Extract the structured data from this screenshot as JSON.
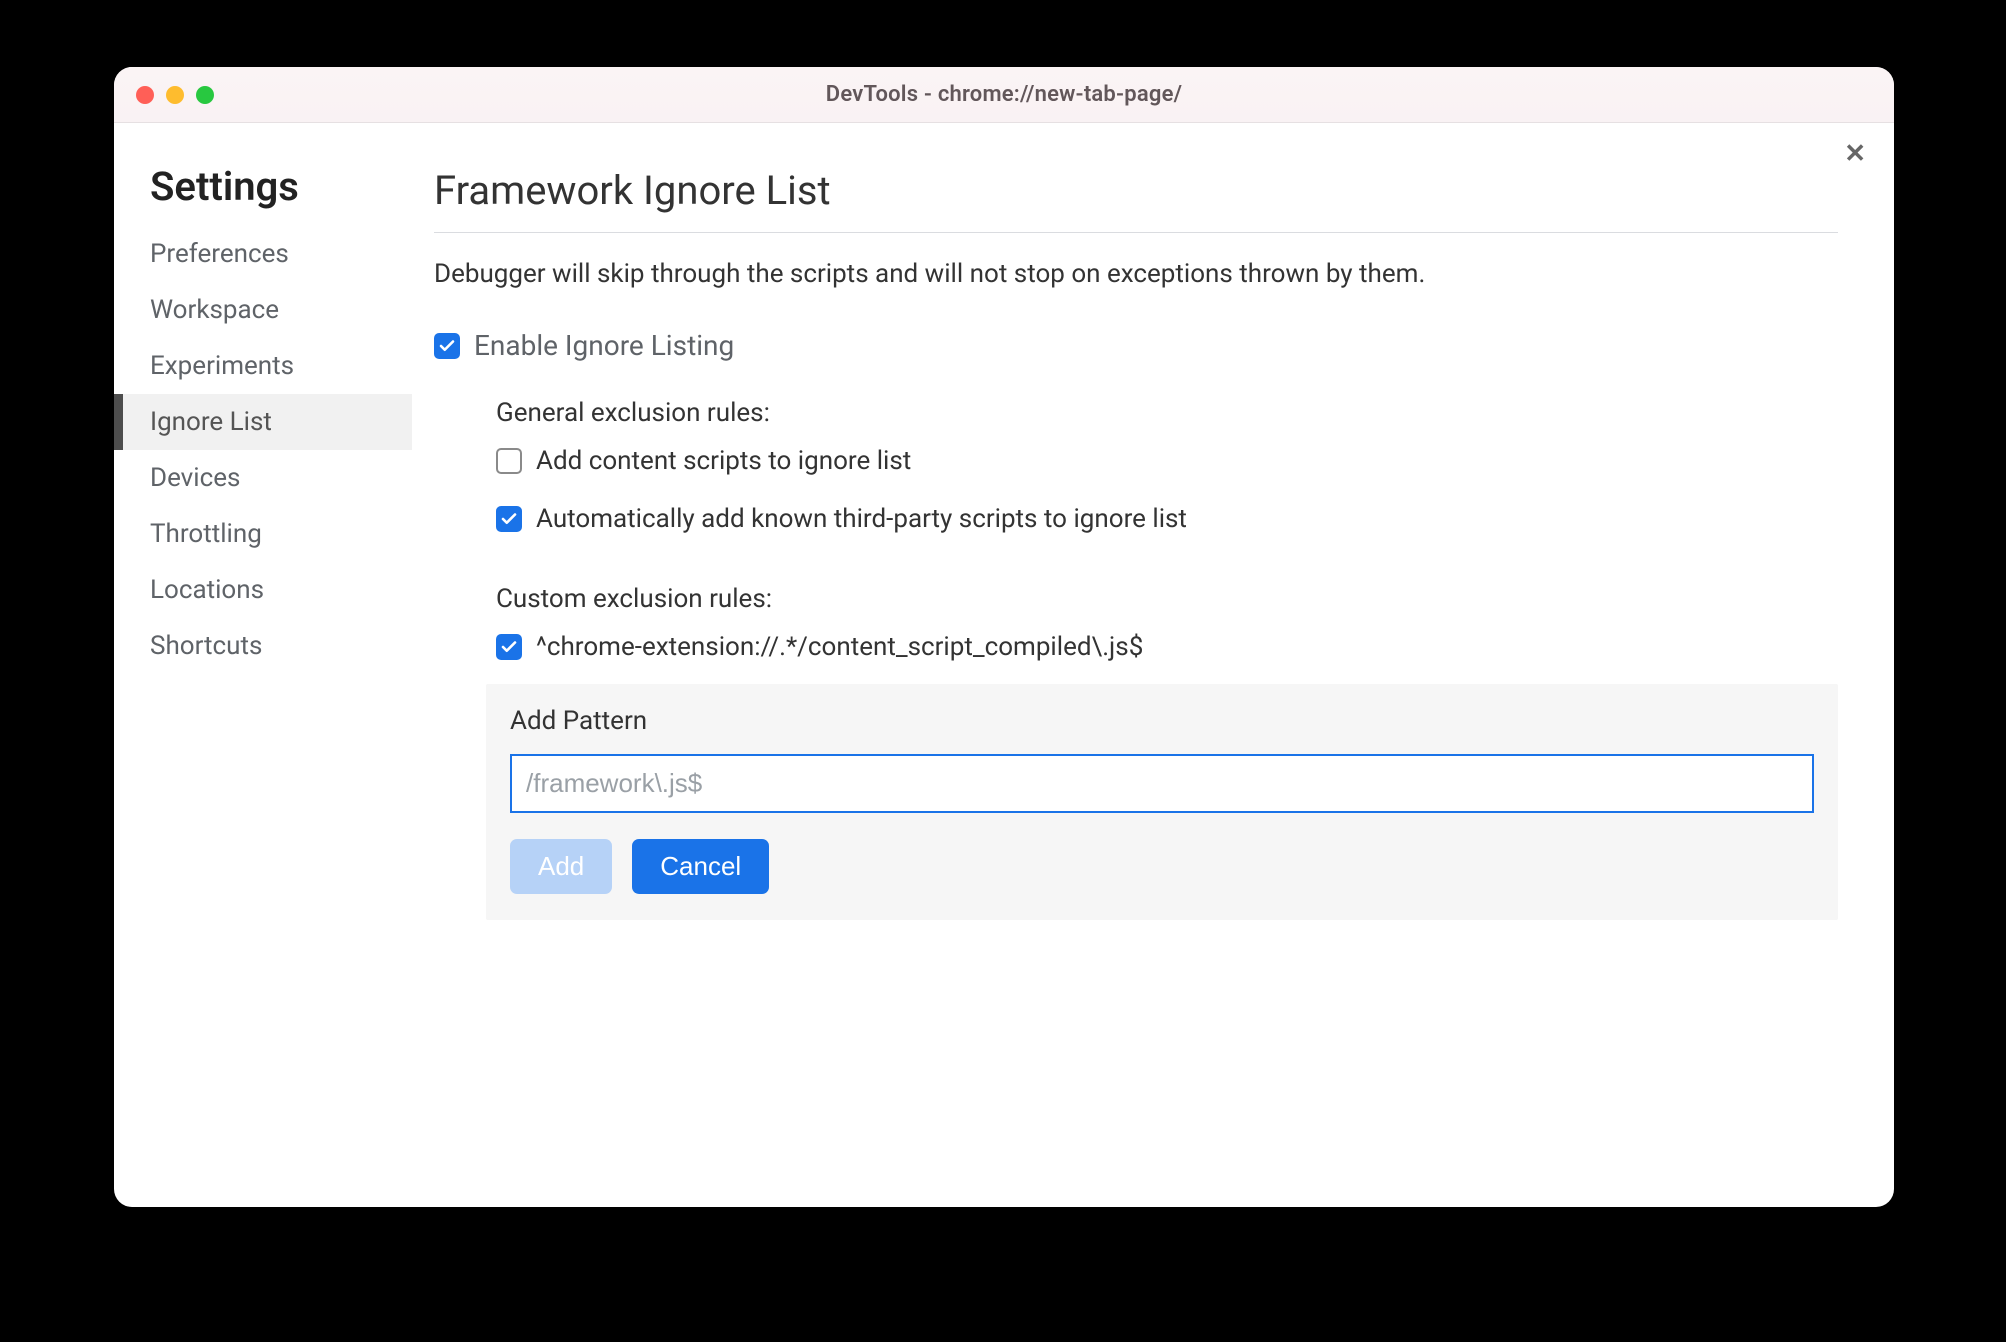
{
  "window": {
    "title": "DevTools - chrome://new-tab-page/"
  },
  "sidebar": {
    "title": "Settings",
    "items": [
      {
        "label": "Preferences",
        "active": false
      },
      {
        "label": "Workspace",
        "active": false
      },
      {
        "label": "Experiments",
        "active": false
      },
      {
        "label": "Ignore List",
        "active": true
      },
      {
        "label": "Devices",
        "active": false
      },
      {
        "label": "Throttling",
        "active": false
      },
      {
        "label": "Locations",
        "active": false
      },
      {
        "label": "Shortcuts",
        "active": false
      }
    ]
  },
  "main": {
    "title": "Framework Ignore List",
    "description": "Debugger will skip through the scripts and will not stop on exceptions thrown by them.",
    "enable_label": "Enable Ignore Listing",
    "enable_checked": true,
    "general_heading": "General exclusion rules:",
    "general_rules": [
      {
        "label": "Add content scripts to ignore list",
        "checked": false
      },
      {
        "label": "Automatically add known third-party scripts to ignore list",
        "checked": true
      }
    ],
    "custom_heading": "Custom exclusion rules:",
    "custom_rules": [
      {
        "label": "^chrome-extension://.*/content_script_compiled\\.js$",
        "checked": true
      }
    ],
    "add_pattern": {
      "title": "Add Pattern",
      "placeholder": "/framework\\.js$",
      "value": "",
      "add_label": "Add",
      "cancel_label": "Cancel"
    }
  },
  "close_glyph": "✕"
}
